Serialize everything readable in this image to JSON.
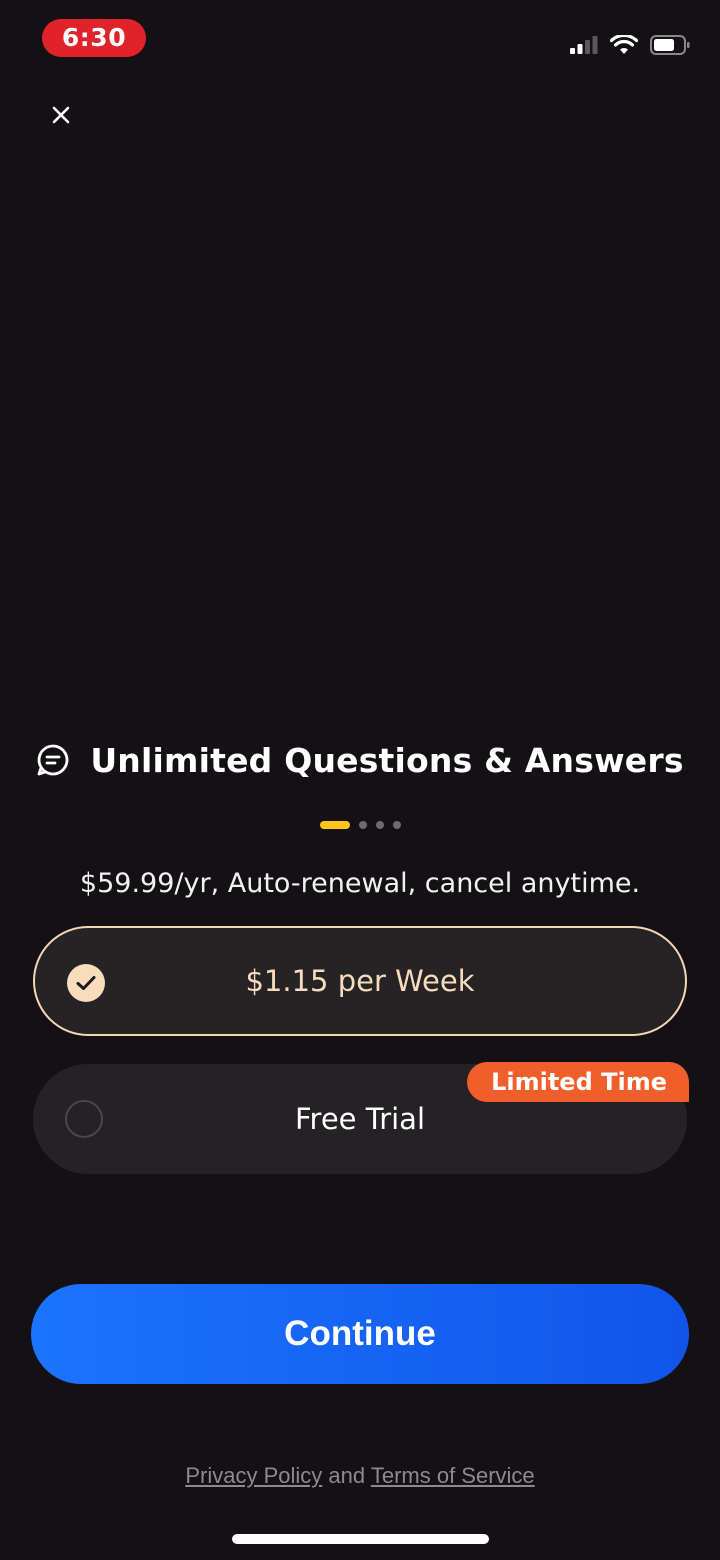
{
  "status_bar": {
    "time": "6:30",
    "icons": [
      "cellular-signal-icon",
      "wifi-icon",
      "battery-icon"
    ]
  },
  "close_icon": "close-icon",
  "feature": {
    "icon": "chat-bubble-icon",
    "title": "Unlimited Questions & Answers",
    "pager": {
      "count": 4,
      "active_index": 0
    }
  },
  "pricing_note": "$59.99/yr, Auto-renewal, cancel anytime.",
  "plans": [
    {
      "label": "$1.15 per Week",
      "selected": true
    },
    {
      "label": "Free Trial",
      "selected": false,
      "badge": "Limited Time"
    }
  ],
  "continue_label": "Continue",
  "legal": {
    "privacy": "Privacy Policy",
    "and": "and",
    "terms": "Terms of Service"
  },
  "colors": {
    "background": "#141114",
    "accent_blue": "#1a74ff",
    "badge_orange": "#f05f2b",
    "selected_border": "#f4d8b6",
    "pager_active": "#ffc51a",
    "time_pill": "#e0222b"
  }
}
